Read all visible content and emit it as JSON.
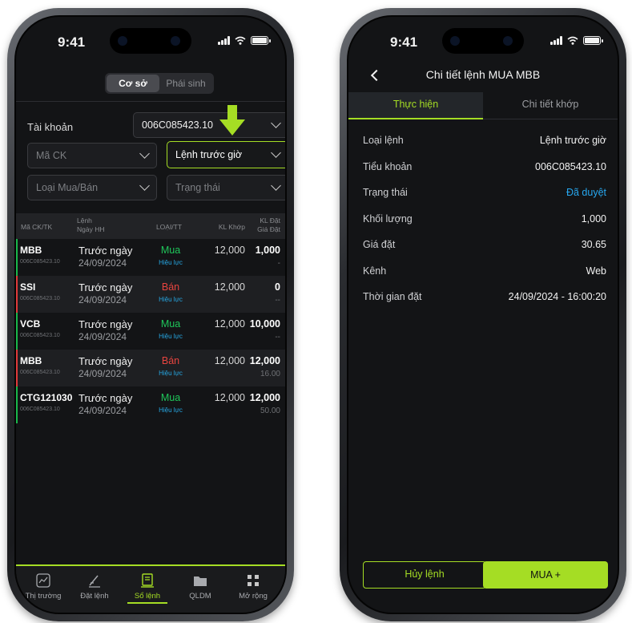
{
  "left_phone": {
    "status_time": "9:41",
    "segment": {
      "tabs": [
        "Cơ sở",
        "Phái sinh"
      ],
      "active": "Cơ sở"
    },
    "account_label": "Tài khoản",
    "account_value": "006C085423.10",
    "filters": {
      "symbol_placeholder": "Mã CK",
      "order_type_value": "Lệnh trước giờ",
      "side_placeholder": "Loại Mua/Bán",
      "status_placeholder": "Trạng thái"
    },
    "table_headers": {
      "symbol": "Mã CK/TK",
      "order_line1": "Lệnh",
      "order_line2": "Ngày HH",
      "side": "LOẠI/TT",
      "matched": "KL Khớp",
      "qty_line1": "KL Đặt",
      "qty_line2": "Giá Đặt"
    },
    "orders": [
      {
        "symbol": "MBB",
        "account": "006C085423.10",
        "type": "Trước ngày",
        "date": "24/09/2024",
        "side": "Mua",
        "status": "Hiệu lực",
        "matched": "12,000",
        "qty": "1,000",
        "price": "-",
        "side_kind": "buy"
      },
      {
        "symbol": "SSI",
        "account": "006C085423.10",
        "type": "Trước ngày",
        "date": "24/09/2024",
        "side": "Bán",
        "status": "Hiệu lực",
        "matched": "12,000",
        "qty": "0",
        "price": "--",
        "side_kind": "sell"
      },
      {
        "symbol": "VCB",
        "account": "006C085423.10",
        "type": "Trước ngày",
        "date": "24/09/2024",
        "side": "Mua",
        "status": "Hiệu lực",
        "matched": "12,000",
        "qty": "10,000",
        "price": "--",
        "side_kind": "buy"
      },
      {
        "symbol": "MBB",
        "account": "006C085423.10",
        "type": "Trước ngày",
        "date": "24/09/2024",
        "side": "Bán",
        "status": "Hiệu lực",
        "matched": "12,000",
        "qty": "12,000",
        "price": "16.00",
        "side_kind": "sell"
      },
      {
        "symbol": "CTG121030",
        "account": "006C085423.10",
        "type": "Trước ngày",
        "date": "24/09/2024",
        "side": "Mua",
        "status": "Hiệu lực",
        "matched": "12,000",
        "qty": "12,000",
        "price": "50.00",
        "side_kind": "buy"
      }
    ],
    "tabbar": [
      {
        "label": "Thị trường",
        "icon": "chart-icon"
      },
      {
        "label": "Đặt lệnh",
        "icon": "pen-icon"
      },
      {
        "label": "Sổ lệnh",
        "icon": "notebook-icon"
      },
      {
        "label": "QLDM",
        "icon": "folder-icon"
      },
      {
        "label": "Mở rộng",
        "icon": "grid-icon"
      }
    ],
    "active_tab": "Sổ lệnh"
  },
  "right_phone": {
    "status_time": "9:41",
    "title": "Chi tiết lệnh MUA MBB",
    "tabs": [
      "Thực hiện",
      "Chi tiết khớp"
    ],
    "details": [
      {
        "key": "Loại lệnh",
        "value": "Lệnh trước giờ"
      },
      {
        "key": "Tiểu khoản",
        "value": "006C085423.10"
      },
      {
        "key": "Trạng thái",
        "value": "Đã duyệt"
      },
      {
        "key": "Khối lượng",
        "value": "1,000"
      },
      {
        "key": "Giá đặt",
        "value": "30.65"
      },
      {
        "key": "Kênh",
        "value": "Web"
      },
      {
        "key": "Thời gian đặt",
        "value": "24/09/2024 - 16:00:20"
      }
    ],
    "cancel_label": "Hủy lệnh",
    "buy_label": "MUA +"
  },
  "colors": {
    "accent": "#a5dd24",
    "buy": "#1fc65a",
    "sell": "#e8443f",
    "info": "#27a8f0",
    "background": "#131416"
  }
}
